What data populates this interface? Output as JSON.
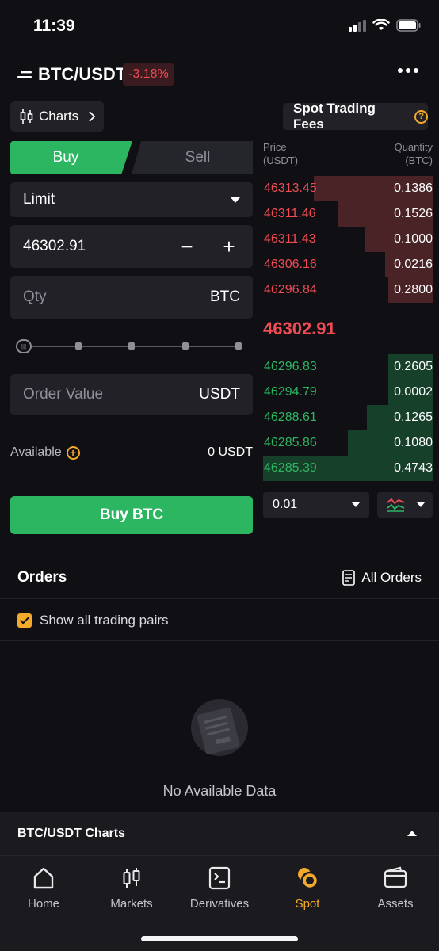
{
  "status_bar": {
    "time": "11:39"
  },
  "header": {
    "pair": "BTC/USDT",
    "change": "-3.18%"
  },
  "toolbar": {
    "charts_label": "Charts",
    "fees_label": "Spot Trading Fees"
  },
  "order_form": {
    "buy_tab": "Buy",
    "sell_tab": "Sell",
    "order_type": "Limit",
    "price_value": "46302.91",
    "minus": "−",
    "plus": "+",
    "qty_placeholder": "Qty",
    "qty_unit": "BTC",
    "order_value_placeholder": "Order Value",
    "order_value_unit": "USDT",
    "slider_percent": 0,
    "available_label": "Available",
    "available_value": "0 USDT",
    "buy_button": "Buy BTC"
  },
  "order_book": {
    "price_header_line1": "Price",
    "price_header_line2": "(USDT)",
    "qty_header_line1": "Quantity",
    "qty_header_line2": "(BTC)",
    "asks": [
      {
        "price": "46313.45",
        "qty": "0.1386",
        "depth": 0.7
      },
      {
        "price": "46311.46",
        "qty": "0.1526",
        "depth": 0.56
      },
      {
        "price": "46311.43",
        "qty": "0.1000",
        "depth": 0.4
      },
      {
        "price": "46306.16",
        "qty": "0.0216",
        "depth": 0.28
      },
      {
        "price": "46296.84",
        "qty": "0.2800",
        "depth": 0.26
      }
    ],
    "last_price": "46302.91",
    "bids": [
      {
        "price": "46296.83",
        "qty": "0.2605",
        "depth": 0.26
      },
      {
        "price": "46294.79",
        "qty": "0.0002",
        "depth": 0.26
      },
      {
        "price": "46288.61",
        "qty": "0.1265",
        "depth": 0.39
      },
      {
        "price": "46285.86",
        "qty": "0.1080",
        "depth": 0.5
      },
      {
        "price": "46285.39",
        "qty": "0.4743",
        "depth": 1.0
      }
    ],
    "step": "0.01"
  },
  "orders": {
    "title": "Orders",
    "all_orders": "All Orders",
    "show_all_pairs": "Show all trading pairs",
    "empty_text": "No Available Data"
  },
  "charts_bar": {
    "title": "BTC/USDT Charts"
  },
  "tab_bar": {
    "items": [
      {
        "label": "Home"
      },
      {
        "label": "Markets"
      },
      {
        "label": "Derivatives"
      },
      {
        "label": "Spot"
      },
      {
        "label": "Assets"
      }
    ]
  },
  "colors": {
    "buy_green": "#2db662",
    "sell_red": "#ef4b55",
    "accent_orange": "#f3a92a",
    "background": "#101014"
  }
}
